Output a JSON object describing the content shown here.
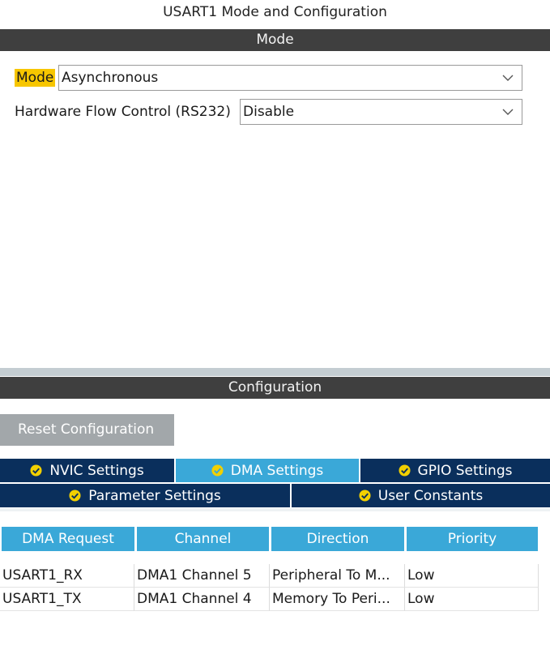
{
  "window_title": "USART1 Mode and Configuration",
  "mode_section": {
    "header": "Mode",
    "mode_label": "Mode",
    "mode_value": "Asynchronous",
    "flow_label": "Hardware Flow Control (RS232)",
    "flow_value": "Disable"
  },
  "config_section": {
    "header": "Configuration",
    "reset_label": "Reset Configuration"
  },
  "tabs": [
    {
      "label": "NVIC Settings",
      "active": false
    },
    {
      "label": "DMA Settings",
      "active": true
    },
    {
      "label": "GPIO Settings",
      "active": false
    },
    {
      "label": "Parameter Settings",
      "active": false
    },
    {
      "label": "User Constants",
      "active": false
    }
  ],
  "dma_table": {
    "headers": [
      "DMA Request",
      "Channel",
      "Direction",
      "Priority"
    ],
    "rows": [
      [
        "USART1_RX",
        "DMA1 Channel 5",
        "Peripheral To M...",
        "Low"
      ],
      [
        "USART1_TX",
        "DMA1 Channel 4",
        "Memory To Peri...",
        "Low"
      ]
    ]
  },
  "colors": {
    "section_bar": "#3f3f3f",
    "highlight": "#f7c600",
    "tab_dark": "#0a2f5c",
    "tab_active": "#3aa8d8",
    "button_gray": "#a2a7aa"
  },
  "icons": {
    "dropdown": "chevron-down-icon",
    "tab_check": "check-circle-icon"
  }
}
